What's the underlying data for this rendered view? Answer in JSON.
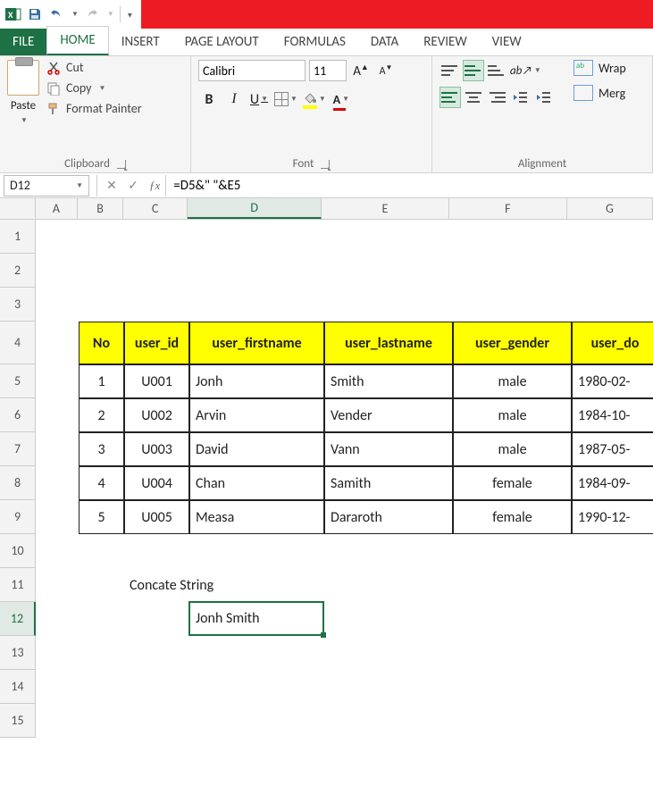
{
  "colors": {
    "accent": "#1e7145",
    "titlebar_red": "#ed1c24",
    "table_header_bg": "#ffff00"
  },
  "titlebar": {
    "qat": {
      "save": "save-icon",
      "undo": "undo-icon",
      "redo": "redo-icon",
      "customize": "customize-icon"
    }
  },
  "tabs": {
    "file": "FILE",
    "items": [
      "HOME",
      "INSERT",
      "PAGE LAYOUT",
      "FORMULAS",
      "DATA",
      "REVIEW",
      "VIEW"
    ],
    "active_index": 0
  },
  "ribbon": {
    "clipboard": {
      "paste": "Paste",
      "cut": "Cut",
      "copy": "Copy",
      "format_painter": "Format Painter",
      "group_label": "Clipboard"
    },
    "font": {
      "name": "Calibri",
      "size": "11",
      "group_label": "Font"
    },
    "align": {
      "wrap": "Wrap",
      "merge": "Merg",
      "group_label": "Alignment"
    }
  },
  "namebox": "D12",
  "formula": "=D5&\" \"&E5",
  "columns": {
    "labels": [
      "A",
      "B",
      "C",
      "D",
      "E",
      "F",
      "G"
    ],
    "widths": [
      48,
      51,
      73,
      151,
      144,
      133,
      97
    ],
    "selected": "D"
  },
  "rows": {
    "count": 15,
    "heights": {
      "default": 38,
      "header_row": 48
    },
    "selected": 12
  },
  "sheet": {
    "headers": [
      "No",
      "user_id",
      "user_firstname",
      "user_lastname",
      "user_gender",
      "user_do"
    ],
    "data": [
      {
        "no": "1",
        "user_id": "U001",
        "fn": "Jonh",
        "ln": "Smith",
        "g": "male",
        "d": "1980-02-"
      },
      {
        "no": "2",
        "user_id": "U002",
        "fn": "Arvin",
        "ln": "Vender",
        "g": "male",
        "d": "1984-10-"
      },
      {
        "no": "3",
        "user_id": "U003",
        "fn": "David",
        "ln": "Vann",
        "g": "male",
        "d": "1987-05-"
      },
      {
        "no": "4",
        "user_id": "U004",
        "fn": "Chan",
        "ln": "Samith",
        "g": "female",
        "d": "1984-09-"
      },
      {
        "no": "5",
        "user_id": "U005",
        "fn": "Measa",
        "ln": "Dararoth",
        "g": "female",
        "d": "1990-12-"
      }
    ],
    "c11_label": "Concate String",
    "d12_value": "Jonh Smith"
  }
}
